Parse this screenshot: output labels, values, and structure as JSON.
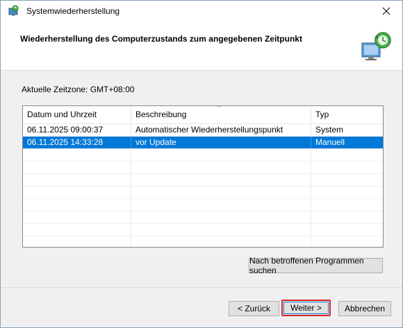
{
  "window": {
    "title": "Systemwiederherstellung"
  },
  "header": {
    "title": "Wiederherstellung des Computerzustands zum angegebenen Zeitpunkt"
  },
  "timezone": "Aktuelle Zeitzone: GMT+08:00",
  "table": {
    "columns": [
      "Datum und Uhrzeit",
      "Beschreibung",
      "Typ"
    ],
    "sort_indicator": "^",
    "rows": [
      {
        "date": "06.11.2025 09:00:37",
        "description": "Automatischer Wiederherstellungspunkt",
        "type": "System",
        "selected": false
      },
      {
        "date": "06.11.2025 14:33:28",
        "description": "vor Update",
        "type": "Manuell",
        "selected": true
      }
    ]
  },
  "buttons": {
    "scan": "Nach betroffenen Programmen suchen",
    "back": "< Zurück",
    "next": "Weiter >",
    "cancel": "Abbrechen"
  },
  "colors": {
    "selection": "#0078d7",
    "highlight_border": "#e02020"
  }
}
